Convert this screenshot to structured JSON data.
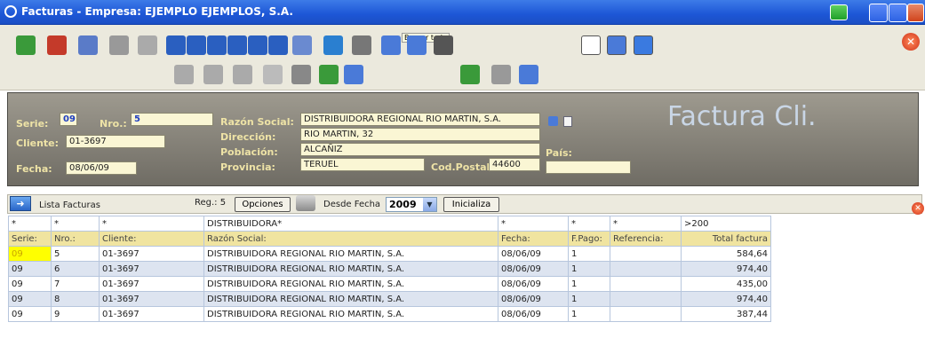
{
  "window": {
    "title": "Facturas - Empresa: EJEMPLO EJEMPLOS, S.A."
  },
  "toolbar": {
    "tooltip": "Buscar todo"
  },
  "header": {
    "serie_label": "Serie:",
    "serie": "09",
    "nro_label": "Nro.:",
    "nro": "5",
    "cliente_label": "Cliente:",
    "cliente": "01-3697",
    "fecha_label": "Fecha:",
    "fecha": "08/06/09",
    "razon_label": "Razón Social:",
    "razon": "DISTRIBUIDORA REGIONAL RIO MARTIN, S.A.",
    "direccion_label": "Dirección:",
    "direccion": "RIO MARTIN, 32",
    "poblacion_label": "Población:",
    "poblacion": "ALCAÑIZ",
    "provincia_label": "Provincia:",
    "provincia": "TERUEL",
    "cp_label": "Cod.Postal:",
    "cp": "44600",
    "pais_label": "País:",
    "pais": "",
    "big_title": "Factura Cli."
  },
  "listbar": {
    "label": "Lista Facturas",
    "reg": "Reg.: 5",
    "opciones": "Opciones",
    "desde": "Desde Fecha",
    "year": "2009",
    "inicializa": "Inicializa"
  },
  "filters": [
    "*",
    "*",
    "*",
    "DISTRIBUIDORA*",
    "*",
    "*",
    "*",
    ">200"
  ],
  "columns": [
    "Serie:",
    "Nro.:",
    "Cliente:",
    "Razón Social:",
    "Fecha:",
    "F.Pago:",
    "Referencia:",
    "Total factura"
  ],
  "rows": [
    [
      "09",
      "5",
      "01-3697",
      "DISTRIBUIDORA REGIONAL RIO MARTIN, S.A.",
      "08/06/09",
      "1",
      "",
      "584,64"
    ],
    [
      "09",
      "6",
      "01-3697",
      "DISTRIBUIDORA REGIONAL RIO MARTIN, S.A.",
      "08/06/09",
      "1",
      "",
      "974,40"
    ],
    [
      "09",
      "7",
      "01-3697",
      "DISTRIBUIDORA REGIONAL RIO MARTIN, S.A.",
      "08/06/09",
      "1",
      "",
      "435,00"
    ],
    [
      "09",
      "8",
      "01-3697",
      "DISTRIBUIDORA REGIONAL RIO MARTIN, S.A.",
      "08/06/09",
      "1",
      "",
      "974,40"
    ],
    [
      "09",
      "9",
      "01-3697",
      "DISTRIBUIDORA REGIONAL RIO MARTIN, S.A.",
      "08/06/09",
      "1",
      "",
      "387,44"
    ]
  ],
  "colors": {
    "titlebar": "#1d56d6",
    "header_bg": "#6f6c64",
    "label": "#eee3a6",
    "field": "#faf6d4",
    "selected": "#ffff00"
  }
}
